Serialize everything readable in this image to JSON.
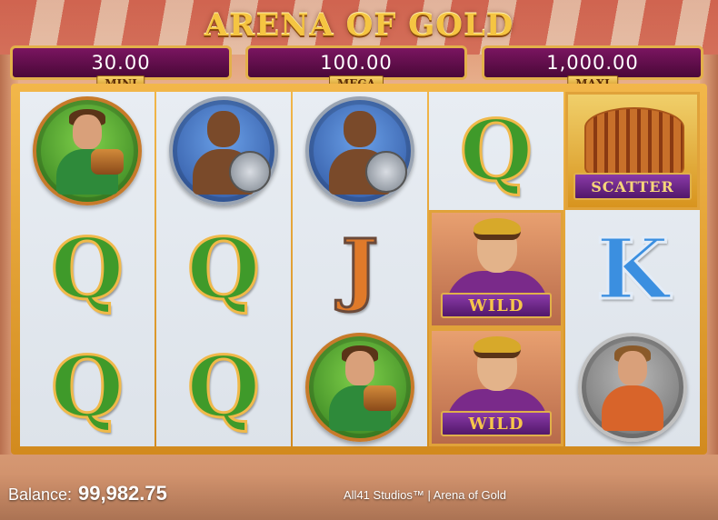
{
  "game": {
    "title": "ARENA OF GOLD"
  },
  "jackpots": {
    "mini": {
      "value": "30.00",
      "label": "MINI"
    },
    "mega": {
      "value": "100.00",
      "label": "MEGA"
    },
    "maxi": {
      "value": "1,000.00",
      "label": "MAXI"
    }
  },
  "reels": [
    [
      "gladiator-green-medallion",
      "Q",
      "Q"
    ],
    [
      "spearman-blue-medallion",
      "Q",
      "Q"
    ],
    [
      "spearman-blue-medallion",
      "J",
      "gladiator-green-medallion"
    ],
    [
      "Q",
      "WILD",
      "WILD"
    ],
    [
      "SCATTER",
      "K",
      "gladiator-orange-medallion"
    ]
  ],
  "symbols": {
    "q": "Q",
    "j": "J",
    "k": "K",
    "wild": "WILD",
    "scatter": "SCATTER"
  },
  "footer": {
    "balance_label": "Balance:",
    "balance_value": "99,982.75",
    "credit": "All41 Studios™  |  Arena of Gold"
  }
}
